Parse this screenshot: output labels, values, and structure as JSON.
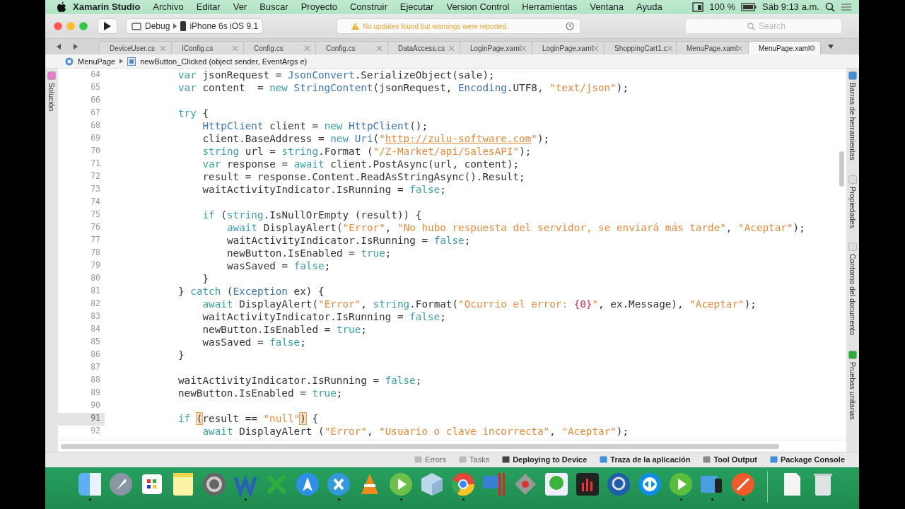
{
  "menu_bar": {
    "app": "Xamarin Studio",
    "items": [
      "Archivo",
      "Editar",
      "Ver",
      "Buscar",
      "Proyecto",
      "Construir",
      "Ejecutar",
      "Version Control",
      "Herramientas",
      "Ventana",
      "Ayuda"
    ],
    "battery": "100 %",
    "clock": "Sáb 9:13 a.m."
  },
  "toolbar": {
    "configuration": "Debug",
    "device": "iPhone 6s iOS 9.1",
    "status_message": "No updates found but warnings were reported.",
    "search": {
      "placeholder": "Search"
    }
  },
  "tabs": [
    {
      "label": "DeviceUser.cs",
      "selected": false
    },
    {
      "label": "IConfig.cs",
      "selected": false
    },
    {
      "label": "Config.cs",
      "selected": false
    },
    {
      "label": "Config.cs",
      "selected": false
    },
    {
      "label": "DataAccess.cs",
      "selected": false
    },
    {
      "label": "LoginPage.xaml",
      "selected": false
    },
    {
      "label": "LoginPage.xaml",
      "selected": false
    },
    {
      "label": "ShoppingCart1.c",
      "selected": false
    },
    {
      "label": "MenuPage.xaml",
      "selected": false
    },
    {
      "label": "MenuPage.xaml",
      "selected": true
    }
  ],
  "breadcrumb": {
    "class": "MenuPage",
    "member": "newButton_Clicked (object sender, EventArgs e)"
  },
  "left_pads": [
    "Solución"
  ],
  "right_pads": [
    "Barras de herramientas",
    "Propiedades",
    "Contorno del documento",
    "Pruebas unitarias"
  ],
  "editor": {
    "lines": [
      {
        "number": "64",
        "current": false,
        "tokens": [
          {
            "kind": "kw",
            "text": "var"
          },
          {
            "kind": "plain",
            "text": " jsonRequest = "
          },
          {
            "kind": "type",
            "text": "JsonConvert"
          },
          {
            "kind": "plain",
            "text": ".SerializeObject(sale);"
          }
        ]
      },
      {
        "number": "65",
        "current": false,
        "tokens": [
          {
            "kind": "kw",
            "text": "var"
          },
          {
            "kind": "plain",
            "text": " content  = "
          },
          {
            "kind": "kw",
            "text": "new "
          },
          {
            "kind": "type",
            "text": "StringContent"
          },
          {
            "kind": "plain",
            "text": "(jsonRequest, "
          },
          {
            "kind": "type",
            "text": "Encoding"
          },
          {
            "kind": "plain",
            "text": ".UTF8, "
          },
          {
            "kind": "str",
            "text": "\"text/json\""
          },
          {
            "kind": "plain",
            "text": ");"
          }
        ]
      },
      {
        "number": "66",
        "current": false
      },
      {
        "number": "67",
        "current": false,
        "tokens": [
          {
            "kind": "kw",
            "text": "try"
          },
          {
            "kind": "plain",
            "text": " {"
          }
        ],
        "children": [
          {
            "number": "68",
            "current": false,
            "tokens": [
              {
                "kind": "type",
                "text": "HttpClient"
              },
              {
                "kind": "plain",
                "text": " client = "
              },
              {
                "kind": "kw",
                "text": "new "
              },
              {
                "kind": "type",
                "text": "HttpClient"
              },
              {
                "kind": "plain",
                "text": "();"
              }
            ]
          },
          {
            "number": "69",
            "current": false,
            "tokens": [
              {
                "kind": "plain",
                "text": "client.BaseAddress = "
              },
              {
                "kind": "kw",
                "text": "new "
              },
              {
                "kind": "type",
                "text": "Uri"
              },
              {
                "kind": "plain",
                "text": "("
              },
              {
                "kind": "str",
                "text": "\""
              },
              {
                "kind": "link",
                "text": "http://zulu-software.com"
              },
              {
                "kind": "str",
                "text": "\""
              },
              {
                "kind": "plain",
                "text": ");"
              }
            ]
          },
          {
            "number": "70",
            "current": false,
            "tokens": [
              {
                "kind": "kw",
                "text": "string"
              },
              {
                "kind": "plain",
                "text": " url = "
              },
              {
                "kind": "kw",
                "text": "string"
              },
              {
                "kind": "plain",
                "text": ".Format ("
              },
              {
                "kind": "str",
                "text": "\"/Z-Market/api/SalesAPI\""
              },
              {
                "kind": "plain",
                "text": ");"
              }
            ]
          },
          {
            "number": "71",
            "current": false,
            "tokens": [
              {
                "kind": "kw",
                "text": "var"
              },
              {
                "kind": "plain",
                "text": " response = "
              },
              {
                "kind": "kw",
                "text": "await"
              },
              {
                "kind": "plain",
                "text": " client.PostAsync(url, content);"
              }
            ]
          },
          {
            "number": "72",
            "current": false,
            "tokens": [
              {
                "kind": "plain",
                "text": "result = response.Content.ReadAsStringAsync().Result;"
              }
            ]
          },
          {
            "number": "73",
            "current": false,
            "tokens": [
              {
                "kind": "plain",
                "text": "waitActivityIndicator.IsRunning = "
              },
              {
                "kind": "kw",
                "text": "false"
              },
              {
                "kind": "plain",
                "text": ";"
              }
            ]
          },
          {
            "number": "74",
            "current": false
          },
          {
            "number": "75",
            "current": false,
            "tokens": [
              {
                "kind": "kw",
                "text": "if"
              },
              {
                "kind": "plain",
                "text": " ("
              },
              {
                "kind": "kw",
                "text": "string"
              },
              {
                "kind": "plain",
                "text": ".IsNullOrEmpty (result)) {"
              }
            ],
            "children": [
              {
                "number": "76",
                "current": false,
                "tokens": [
                  {
                    "kind": "kw",
                    "text": "await"
                  },
                  {
                    "kind": "plain",
                    "text": " DisplayAlert("
                  },
                  {
                    "kind": "str",
                    "text": "\"Error\""
                  },
                  {
                    "kind": "plain",
                    "text": ", "
                  },
                  {
                    "kind": "str",
                    "text": "\"No hubo respuesta del servidor, se enviará más tarde\""
                  },
                  {
                    "kind": "plain",
                    "text": ", "
                  },
                  {
                    "kind": "str",
                    "text": "\"Aceptar\""
                  },
                  {
                    "kind": "plain",
                    "text": ");"
                  }
                ]
              },
              {
                "number": "77",
                "current": false,
                "tokens": [
                  {
                    "kind": "plain",
                    "text": "waitActivityIndicator.IsRunning = "
                  },
                  {
                    "kind": "kw",
                    "text": "false"
                  },
                  {
                    "kind": "plain",
                    "text": ";"
                  }
                ]
              },
              {
                "number": "78",
                "current": false,
                "tokens": [
                  {
                    "kind": "plain",
                    "text": "newButton.IsEnabled = "
                  },
                  {
                    "kind": "kw",
                    "text": "true"
                  },
                  {
                    "kind": "plain",
                    "text": ";"
                  }
                ]
              },
              {
                "number": "79",
                "current": false,
                "tokens": [
                  {
                    "kind": "plain",
                    "text": "wasSaved = "
                  },
                  {
                    "kind": "kw",
                    "text": "false"
                  },
                  {
                    "kind": "plain",
                    "text": ";"
                  }
                ]
              }
            ]
          },
          {
            "number": "80",
            "current": false,
            "tokens": [
              {
                "kind": "plain",
                "text": "}"
              }
            ]
          }
        ]
      },
      {
        "number": "81",
        "current": false,
        "tokens": [
          {
            "kind": "plain",
            "text": "} "
          },
          {
            "kind": "kw",
            "text": "catch"
          },
          {
            "kind": "plain",
            "text": " ("
          },
          {
            "kind": "type",
            "text": "Exception"
          },
          {
            "kind": "plain",
            "text": " ex) {"
          }
        ],
        "children": [
          {
            "number": "82",
            "current": false,
            "tokens": [
              {
                "kind": "kw",
                "text": "await"
              },
              {
                "kind": "plain",
                "text": " DisplayAlert("
              },
              {
                "kind": "str",
                "text": "\"Error\""
              },
              {
                "kind": "plain",
                "text": ", "
              },
              {
                "kind": "kw",
                "text": "string"
              },
              {
                "kind": "plain",
                "text": ".Format("
              },
              {
                "kind": "str",
                "text": "\"Ocurrio el error: "
              },
              {
                "kind": "format",
                "text": "{0}"
              },
              {
                "kind": "str",
                "text": "\""
              },
              {
                "kind": "plain",
                "text": ", ex.Message), "
              },
              {
                "kind": "str",
                "text": "\"Aceptar\""
              },
              {
                "kind": "plain",
                "text": ");"
              }
            ]
          },
          {
            "number": "83",
            "current": false,
            "tokens": [
              {
                "kind": "plain",
                "text": "waitActivityIndicator.IsRunning = "
              },
              {
                "kind": "kw",
                "text": "false"
              },
              {
                "kind": "plain",
                "text": ";"
              }
            ]
          },
          {
            "number": "84",
            "current": false,
            "tokens": [
              {
                "kind": "plain",
                "text": "newButton.IsEnabled = "
              },
              {
                "kind": "kw",
                "text": "true"
              },
              {
                "kind": "plain",
                "text": ";"
              }
            ]
          },
          {
            "number": "85",
            "current": false,
            "tokens": [
              {
                "kind": "plain",
                "text": "wasSaved = "
              },
              {
                "kind": "kw",
                "text": "false"
              },
              {
                "kind": "plain",
                "text": ";"
              }
            ]
          }
        ]
      },
      {
        "number": "86",
        "current": false,
        "tokens": [
          {
            "kind": "plain",
            "text": "}"
          }
        ]
      },
      {
        "number": "87",
        "current": false
      },
      {
        "number": "88",
        "current": false,
        "tokens": [
          {
            "kind": "plain",
            "text": "waitActivityIndicator.IsRunning = "
          },
          {
            "kind": "kw",
            "text": "false"
          },
          {
            "kind": "plain",
            "text": ";"
          }
        ]
      },
      {
        "number": "89",
        "current": false,
        "tokens": [
          {
            "kind": "plain",
            "text": "newButton.IsEnabled = "
          },
          {
            "kind": "kw",
            "text": "true"
          },
          {
            "kind": "plain",
            "text": ";"
          }
        ]
      },
      {
        "number": "90",
        "current": false
      },
      {
        "number": "91",
        "current": true,
        "tokens": [
          {
            "kind": "kw",
            "text": "if "
          },
          {
            "kind": "bracket",
            "text": "("
          },
          {
            "kind": "plain",
            "text": "result == "
          },
          {
            "kind": "str",
            "text": "\"null\""
          },
          {
            "kind": "bracket",
            "text": ")"
          },
          {
            "kind": "plain",
            "text": " {"
          }
        ],
        "children": [
          {
            "number": "92",
            "current": false,
            "tokens": [
              {
                "kind": "kw",
                "text": "await"
              },
              {
                "kind": "plain",
                "text": " DisplayAlert ("
              },
              {
                "kind": "str",
                "text": "\"Error\""
              },
              {
                "kind": "plain",
                "text": ", "
              },
              {
                "kind": "str",
                "text": "\"Usuario o clave incorrecta\""
              },
              {
                "kind": "plain",
                "text": ", "
              },
              {
                "kind": "str",
                "text": "\"Aceptar\""
              },
              {
                "kind": "plain",
                "text": ");"
              }
            ]
          }
        ]
      }
    ]
  },
  "bottom_pads": [
    {
      "label": "Errors",
      "active": false
    },
    {
      "label": "Tasks",
      "active": false
    },
    {
      "label": "Deploying to Device",
      "active": true
    },
    {
      "label": "Traza de la aplicación",
      "active": true
    },
    {
      "label": "Tool Output",
      "active": true
    },
    {
      "label": "Package Console",
      "active": true
    }
  ],
  "dock": {
    "items": [
      {
        "running": true
      },
      {
        "running": false
      },
      {
        "running": false
      },
      {
        "running": false
      },
      {
        "running": false
      },
      {
        "running": true
      },
      {
        "running": false
      },
      {
        "running": false
      },
      {
        "running": true
      },
      {
        "running": false
      },
      {
        "running": true
      },
      {
        "running": false
      },
      {
        "running": true
      },
      {
        "running": false
      },
      {
        "running": false
      },
      {
        "running": false
      },
      {
        "running": false
      },
      {
        "running": false
      },
      {
        "running": false
      },
      {
        "running": true
      },
      {
        "running": true
      },
      {
        "running": true
      },
      {
        "running": false
      },
      {
        "running": false
      }
    ]
  }
}
